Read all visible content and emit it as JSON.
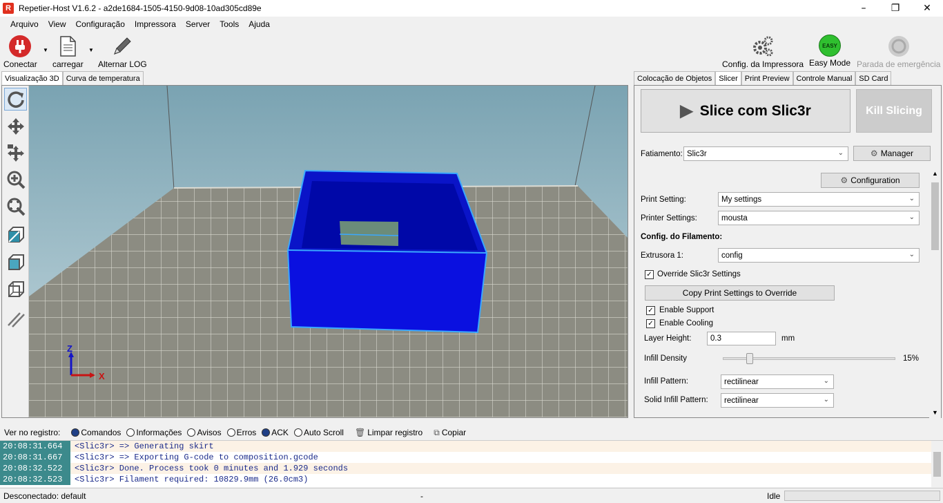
{
  "window": {
    "title": "Repetier-Host V1.6.2 - a2de1684-1505-4150-9d08-10ad305cd89e",
    "logo": "R"
  },
  "menu": [
    "Arquivo",
    "View",
    "Configuração",
    "Impressora",
    "Server",
    "Tools",
    "Ajuda"
  ],
  "toolbar": {
    "connect": "Conectar",
    "load": "carregar",
    "toggle_log": "Alternar LOG",
    "printer_config": "Config. da Impressora",
    "easy_mode": "Easy Mode",
    "easy_badge": "EASY",
    "emergency_stop": "Parada de emergência"
  },
  "left_tabs": [
    "Visualização 3D",
    "Curva de temperatura"
  ],
  "right_tabs": [
    "Colocação de Objetos",
    "Slicer",
    "Print Preview",
    "Controle Manual",
    "SD Card"
  ],
  "axes": {
    "z": "Z",
    "x": "X"
  },
  "slicer": {
    "slice_button": "Slice com Slic3r",
    "kill_button": "Kill Slicing",
    "slicer_label": "Fatiamento:",
    "slicer_value": "Slic3r",
    "manager_button": "Manager",
    "configuration_button": "Configuration",
    "print_setting_label": "Print Setting:",
    "print_setting_value": "My settings",
    "printer_settings_label": "Printer Settings:",
    "printer_settings_value": "mousta",
    "filament_header": "Config. do Filamento:",
    "extruder_label": "Extrusora 1:",
    "extruder_value": "config",
    "override_label": "Override Slic3r Settings",
    "copy_button": "Copy Print Settings to Override",
    "support_label": "Enable Support",
    "cooling_label": "Enable Cooling",
    "layer_height_label": "Layer Height:",
    "layer_height_value": "0.3",
    "layer_height_unit": "mm",
    "infill_density_label": "Infill Density",
    "infill_density_value": "15%",
    "infill_density_fraction": 0.15,
    "infill_pattern_label": "Infill Pattern:",
    "infill_pattern_value": "rectilinear",
    "solid_infill_label": "Solid Infill Pattern:",
    "solid_infill_value": "rectilinear"
  },
  "logbar": {
    "label": "Ver no registro:",
    "commands": "Comandos",
    "info": "Informações",
    "warnings": "Avisos",
    "errors": "Erros",
    "ack": "ACK",
    "autoscroll": "Auto Scroll",
    "clear": "Limpar registro",
    "copy": "Copiar"
  },
  "log": [
    {
      "time": "20:08:31.664",
      "msg": "<Slic3r> => Generating skirt"
    },
    {
      "time": "20:08:31.667",
      "msg": "<Slic3r> => Exporting G-code to composition.gcode"
    },
    {
      "time": "20:08:32.522",
      "msg": "<Slic3r> Done. Process took 0 minutes and 1.929 seconds"
    },
    {
      "time": "20:08:32.523",
      "msg": "<Slic3r> Filament required: 10829.9mm (26.0cm3)"
    }
  ],
  "status": {
    "connection": "Desconectado: default",
    "middle": "-",
    "state": "Idle"
  },
  "colors": {
    "object": "#0a1ee6",
    "object_edge": "#3aa8ff",
    "wall": "#7fa7b4",
    "bed": "#8a8a80"
  }
}
